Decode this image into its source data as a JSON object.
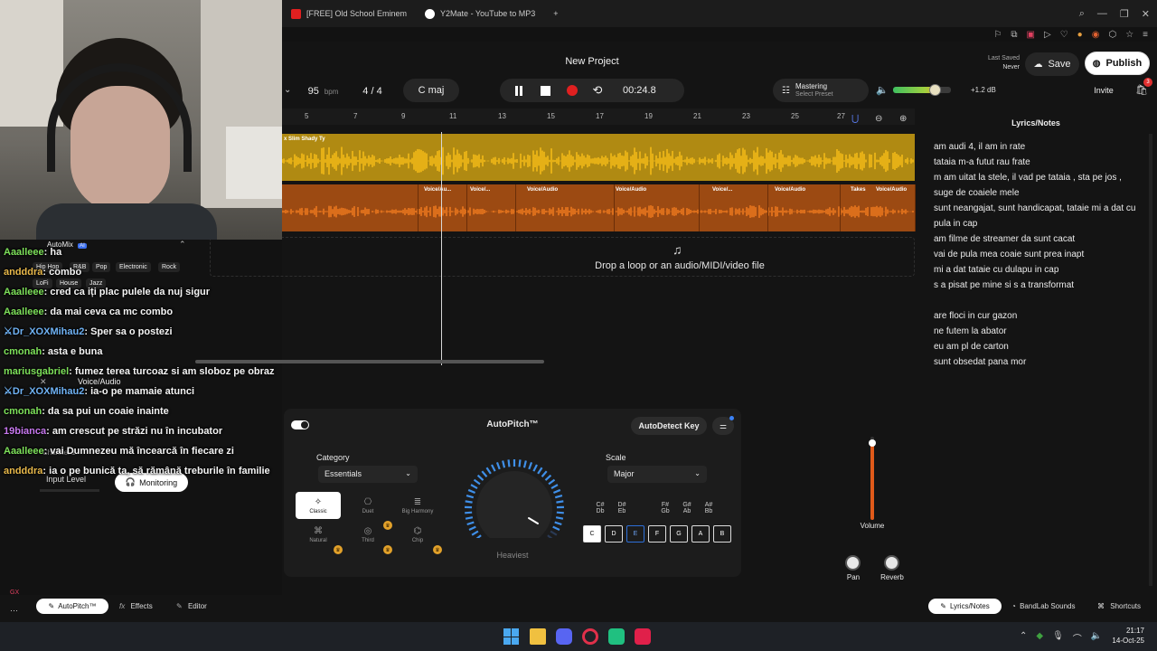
{
  "browser": {
    "tabs": [
      {
        "label": "[FREE] Old School Eminem",
        "icon_color": "#e02020"
      },
      {
        "label": "Y2Mate - YouTube to MP3",
        "icon_color": "#ffffff"
      }
    ],
    "new_tab": "+"
  },
  "project": {
    "title": "New Project",
    "bpm_value": "95",
    "bpm_unit": "bpm",
    "time_signature": "4 / 4",
    "key": "C maj",
    "time": "00:24.8",
    "mastering_label": "Mastering",
    "mastering_sub": "Select Preset",
    "volume_db": "+1.2 dB",
    "last_saved_label": "Last Saved",
    "last_saved_value": "Never",
    "save": "Save",
    "publish": "Publish",
    "invite": "Invite",
    "cart_badge": "3"
  },
  "ruler": [
    "5",
    "7",
    "9",
    "11",
    "13",
    "15",
    "17",
    "19",
    "21",
    "23",
    "25",
    "27"
  ],
  "tracks": {
    "track1_label": "x Slim Shady Ty",
    "clip_labels": [
      "Voice/Au...",
      "Voice/...",
      "Voice/Audio",
      "Voice/Audio",
      "Voice/...",
      "Voice/Audio",
      "Takes",
      "Voice/Audio"
    ],
    "drop_text": "Drop a loop or an audio/MIDI/video file"
  },
  "lyrics": {
    "title": "Lyrics/Notes",
    "lines": [
      "am audi 4, il am in rate",
      "tataia m-a futut rau frate",
      "m am uitat la stele, il vad pe tataia , sta pe jos  , suge de coaiele mele",
      "sunt neangajat, sunt handicapat, tataie mi a dat cu pula in cap",
      "am filme de streamer da sunt cacat",
      "vai de pula mea coaie sunt prea inapt",
      "mi a dat tataie cu dulapu in cap",
      "s a pisat pe mine si s a transformat",
      "",
      "are floci in cur gazon",
      "ne futem la abator",
      "eu am pl de carton",
      "sunt obsedat pana mor"
    ]
  },
  "autopitch": {
    "title": "AutoPitch™",
    "autodetect": "AutoDetect Key",
    "category_label": "Category",
    "category_value": "Essentials",
    "algorithms": [
      "Classic",
      "Duet",
      "Big Harmony",
      "Natural",
      "Third",
      "Chip"
    ],
    "scale_label": "Scale",
    "scale_value": "Major",
    "knob_label": "Heaviest",
    "sharps": [
      [
        "C#",
        "Db"
      ],
      [
        "D#",
        "Eb"
      ],
      [
        "F#",
        "Gb"
      ],
      [
        "G#",
        "Ab"
      ],
      [
        "A#",
        "Bb"
      ]
    ],
    "keys": [
      "C",
      "D",
      "E",
      "F",
      "G",
      "A",
      "B"
    ],
    "volume_label": "Volume",
    "pan_label": "Pan",
    "reverb_label": "Reverb"
  },
  "left_panel": {
    "automix": "AutoMix",
    "ai_badge": "AI",
    "genres": [
      "Hip Hop",
      "R&B",
      "Pop",
      "Electronic",
      "Rock",
      "LoFi",
      "House",
      "Jazz"
    ],
    "voice_audio": "Voice/Audio",
    "channel": "Channel 1",
    "input_level": "Input Level",
    "monitoring": "Monitoring"
  },
  "chat": [
    {
      "user": "Aaalleee",
      "color": "#7de05a",
      "text": "ha"
    },
    {
      "user": "andddra",
      "color": "#e8b84a",
      "text": "combo"
    },
    {
      "user": "Aaalleee",
      "color": "#7de05a",
      "text": "cred ca iți plac pulele da nuj sigur"
    },
    {
      "user": "Aaalleee",
      "color": "#7de05a",
      "text": "da mai ceva ca mc combo"
    },
    {
      "user": "Dr_XOXMihau2",
      "color": "#6fb2f4",
      "text": "Sper sa o postezi",
      "badge": "🗡"
    },
    {
      "user": "cmonah",
      "color": "#7de05a",
      "text": "asta e buna"
    },
    {
      "user": "mariusgabriel",
      "color": "#7de05a",
      "text": "fumez terea turcoaz si am sloboz pe obraz"
    },
    {
      "user": "Dr_XOXMihau2",
      "color": "#6fb2f4",
      "text": "ia-o pe mamaie atunci",
      "badge": "🗡"
    },
    {
      "user": "cmonah",
      "color": "#7de05a",
      "text": "da sa pui un coaie inainte"
    },
    {
      "user": "19bianca",
      "color": "#c878f0",
      "text": "am crescut pe străzi nu în incubator"
    },
    {
      "user": "Aaalleee",
      "color": "#7de05a",
      "text": "vai Dumnezeu mă încearcă în fiecare zi"
    },
    {
      "user": "andddra",
      "color": "#e8b84a",
      "text": "ia o pe bunică ta, să rămână treburile în familie"
    }
  ],
  "bottom": {
    "autopitch_tab": "AutoPitch™",
    "effects_tab": "Effects",
    "editor_tab": "Editor",
    "lyrics_tab": "Lyrics/Notes",
    "sounds_tab": "BandLab Sounds",
    "shortcuts_tab": "Shortcuts"
  },
  "taskbar": {
    "time": "21:17",
    "date": "14-Oct-25"
  }
}
